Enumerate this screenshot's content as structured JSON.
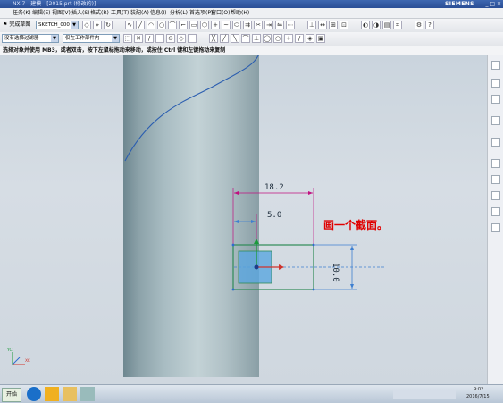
{
  "window": {
    "title": "NX 7 - 建模 - [2015.prt (修改的)]",
    "brand": "SIEMENS"
  },
  "menu": {
    "items": [
      "任务(K)",
      "编辑(E)",
      "视图(V)",
      "插入(S)",
      "格式(R)",
      "工具(T)",
      "装配(A)",
      "信息(I)",
      "分析(L)",
      "首选项(P)",
      "窗口(O)",
      "帮助(H)"
    ]
  },
  "toolbar": {
    "finish_sketch_label": "完成草图",
    "sketch_name": "SKETCH_000",
    "selection_filter": "没有选择过滤器",
    "assembly_filter": "仅在工作部件内"
  },
  "status": {
    "prompt": "选择对象并使用 MB3，或者双击，按下左鼠标拖动来移动，或按住 Ctrl 键和左键拖动来复制"
  },
  "canvas": {
    "dimension_top": "18.2",
    "dimension_mid": "5.0",
    "dimension_right": "10.0",
    "annotation": "画一个截面。",
    "triad_x": "XC",
    "triad_y": "YC"
  },
  "taskbar": {
    "start_label": "开始",
    "time": "9:02",
    "date": "2016/7/15"
  },
  "colors": {
    "sketch_rect": "#2e8b57",
    "dimension": "#c01080",
    "annotation": "#e00000",
    "curve": "#2a5db0"
  }
}
